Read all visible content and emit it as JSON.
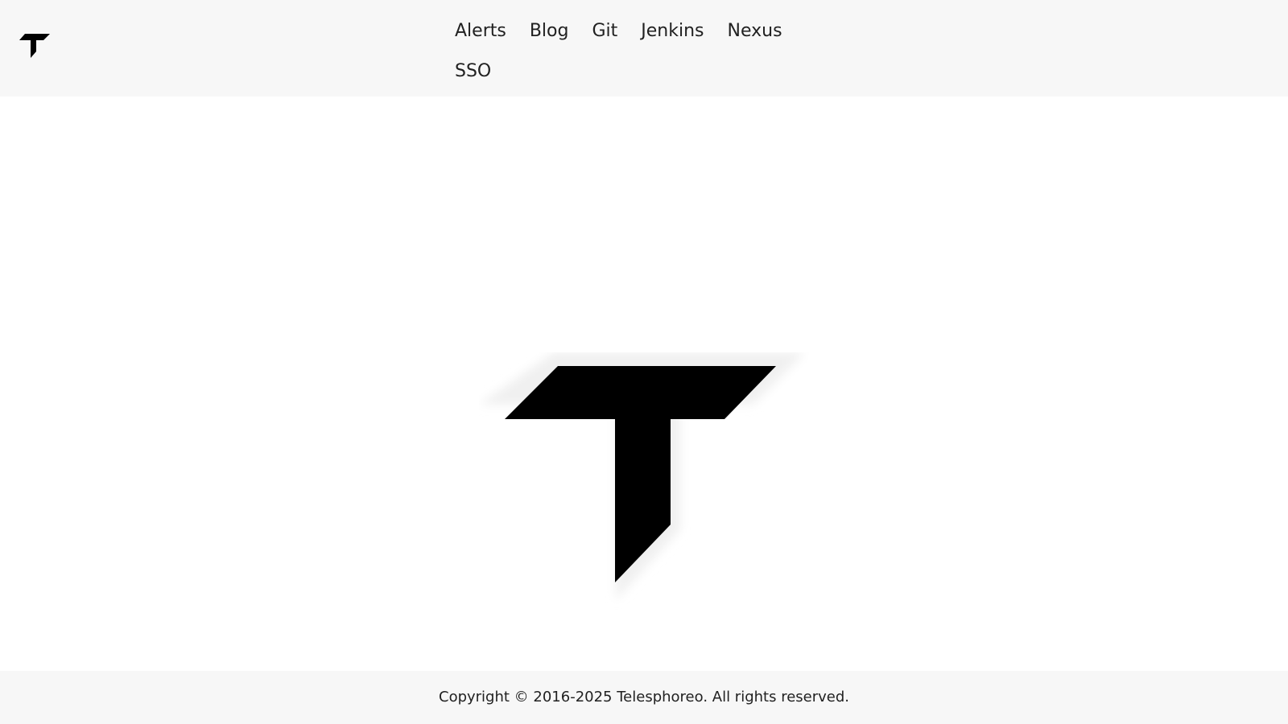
{
  "header": {
    "brand_icon": "telesphoreo-t-logo-icon",
    "nav": [
      {
        "label": "Alerts"
      },
      {
        "label": "Blog"
      },
      {
        "label": "Git"
      },
      {
        "label": "Jenkins"
      },
      {
        "label": "Nexus"
      },
      {
        "label": "SSO"
      }
    ]
  },
  "main": {
    "hero_icon": "telesphoreo-t-logo-icon"
  },
  "footer": {
    "copyright": "Copyright © 2016-2025 Telesphoreo. All rights reserved."
  },
  "colors": {
    "header_bg": "#f7f7f7",
    "footer_bg": "#f7f7f7",
    "page_bg": "#ffffff",
    "text": "#212121",
    "logo": "#000000"
  }
}
